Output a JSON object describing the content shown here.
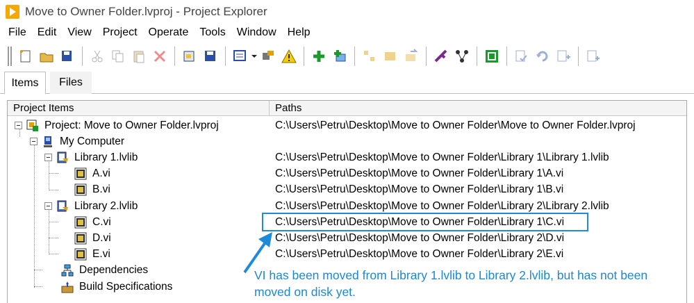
{
  "window": {
    "title": "Move to Owner Folder.lvproj - Project Explorer"
  },
  "menu": [
    "File",
    "Edit",
    "View",
    "Project",
    "Operate",
    "Tools",
    "Window",
    "Help"
  ],
  "tabs": [
    {
      "label": "Items",
      "selected": true
    },
    {
      "label": "Files",
      "selected": false
    }
  ],
  "columns": {
    "items": "Project Items",
    "paths": "Paths"
  },
  "tree": [
    {
      "label": "Project: Move to Owner Folder.lvproj",
      "path": "C:\\Users\\Petru\\Desktop\\Move to Owner Folder\\Move to Owner Folder.lvproj",
      "icon": "project-icon"
    },
    {
      "label": "My Computer",
      "path": "",
      "icon": "computer-icon"
    },
    {
      "label": "Library 1.lvlib",
      "path": "C:\\Users\\Petru\\Desktop\\Move to Owner Folder\\Library 1\\Library 1.lvlib",
      "icon": "library-icon"
    },
    {
      "label": "A.vi",
      "path": "C:\\Users\\Petru\\Desktop\\Move to Owner Folder\\Library 1\\A.vi",
      "icon": "vi-icon"
    },
    {
      "label": "B.vi",
      "path": "C:\\Users\\Petru\\Desktop\\Move to Owner Folder\\Library 1\\B.vi",
      "icon": "vi-icon"
    },
    {
      "label": "Library 2.lvlib",
      "path": "C:\\Users\\Petru\\Desktop\\Move to Owner Folder\\Library 2\\Library 2.lvlib",
      "icon": "library-icon"
    },
    {
      "label": "C.vi",
      "path": "C:\\Users\\Petru\\Desktop\\Move to Owner Folder\\Library 1\\C.vi",
      "icon": "vi-icon"
    },
    {
      "label": "D.vi",
      "path": "C:\\Users\\Petru\\Desktop\\Move to Owner Folder\\Library 2\\D.vi",
      "icon": "vi-icon"
    },
    {
      "label": "E.vi",
      "path": "C:\\Users\\Petru\\Desktop\\Move to Owner Folder\\Library 2\\E.vi",
      "icon": "vi-icon"
    },
    {
      "label": "Dependencies",
      "path": "",
      "icon": "dependencies-icon"
    },
    {
      "label": "Build Specifications",
      "path": "",
      "icon": "build-specifications-icon"
    }
  ],
  "annotation": {
    "text": "VI has been moved from Library 1.lvlib to Library 2.lvlib, but has not been moved on disk yet.",
    "color": "#1a88d4"
  },
  "colors": {
    "highlight": "#1f8ad8",
    "app_icon": "#f5a800"
  }
}
